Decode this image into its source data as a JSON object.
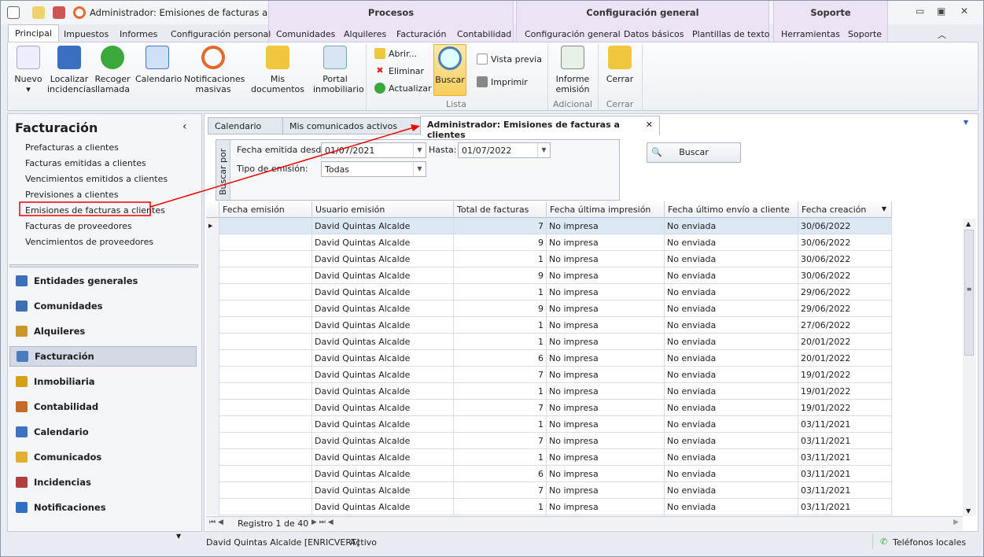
{
  "window": {
    "title": "Administrador: Emisiones de facturas a clientes",
    "minimize": "▭",
    "maximize": "▣",
    "close": "✕",
    "collapse": "︿"
  },
  "context_groups": [
    "Procesos",
    "Configuración general",
    "Soporte"
  ],
  "tabs": [
    "Principal",
    "Impuestos",
    "Informes",
    "Configuración personal",
    "Comunidades",
    "Alquileres",
    "Facturación",
    "Contabilidad",
    "Configuración general",
    "Datos básicos",
    "Plantillas de texto",
    "Herramientas",
    "Soporte"
  ],
  "ribbon": {
    "large": [
      "Nuevo",
      "Localizar incidencias",
      "Recoger llamada",
      "Calendario",
      "Notificaciones masivas",
      "Mis documentos",
      "Portal inmobiliario"
    ],
    "lista_small": [
      "Abrir...",
      "Eliminar",
      "Actualizar"
    ],
    "buscar": "Buscar",
    "print_small": [
      "Vista previa",
      "Imprimir"
    ],
    "informe": "Informe emisión",
    "cerrar": "Cerrar",
    "groups": {
      "lista": "Lista",
      "adicional": "Adicional",
      "cerrar": "Cerrar"
    }
  },
  "left": {
    "title": "Facturación",
    "collapse": "‹",
    "links": [
      "Prefacturas a clientes",
      "Facturas emitidas a clientes",
      "Vencimientos emitidos a clientes",
      "Previsiones a clientes",
      "Emisiones de facturas a clientes",
      "Facturas de proveedores",
      "Vencimientos de proveedores"
    ],
    "modules": [
      "Entidades generales",
      "Comunidades",
      "Alquileres",
      "Facturación",
      "Inmobiliaria",
      "Contabilidad",
      "Calendario",
      "Comunicados",
      "Incidencias",
      "Notificaciones"
    ],
    "module_colors": [
      "#3b6fb6",
      "#3f6fb0",
      "#c8962a",
      "#4b7bc0",
      "#d4a017",
      "#c46a2a",
      "#3f73c0",
      "#e0b030",
      "#b04040",
      "#3070c0"
    ]
  },
  "doc_tabs": [
    "Calendario",
    "Mis comunicados activos",
    "Administrador: Emisiones de facturas a clientes"
  ],
  "filter": {
    "group_label": "Buscar por",
    "desde_label": "Fecha emitida desde:",
    "desde": "01/07/2021",
    "hasta_label": "Hasta:",
    "hasta": "01/07/2022",
    "tipo_label": "Tipo de emisión:",
    "tipo": "Todas",
    "buscar": "Buscar"
  },
  "grid": {
    "columns": [
      "Fecha emisión",
      "Usuario emisión",
      "Total de facturas",
      "Fecha última impresión",
      "Fecha último envío a cliente",
      "Fecha creación"
    ],
    "rows": [
      [
        "",
        "David Quintas Alcalde",
        "7",
        "No impresa",
        "No enviada",
        "30/06/2022"
      ],
      [
        "",
        "David Quintas Alcalde",
        "9",
        "No impresa",
        "No enviada",
        "30/06/2022"
      ],
      [
        "",
        "David Quintas Alcalde",
        "1",
        "No impresa",
        "No enviada",
        "30/06/2022"
      ],
      [
        "",
        "David Quintas Alcalde",
        "9",
        "No impresa",
        "No enviada",
        "30/06/2022"
      ],
      [
        "",
        "David Quintas Alcalde",
        "1",
        "No impresa",
        "No enviada",
        "29/06/2022"
      ],
      [
        "",
        "David Quintas Alcalde",
        "9",
        "No impresa",
        "No enviada",
        "29/06/2022"
      ],
      [
        "",
        "David Quintas Alcalde",
        "1",
        "No impresa",
        "No enviada",
        "27/06/2022"
      ],
      [
        "",
        "David Quintas Alcalde",
        "1",
        "No impresa",
        "No enviada",
        "20/01/2022"
      ],
      [
        "",
        "David Quintas Alcalde",
        "6",
        "No impresa",
        "No enviada",
        "20/01/2022"
      ],
      [
        "",
        "David Quintas Alcalde",
        "7",
        "No impresa",
        "No enviada",
        "19/01/2022"
      ],
      [
        "",
        "David Quintas Alcalde",
        "1",
        "No impresa",
        "No enviada",
        "19/01/2022"
      ],
      [
        "",
        "David Quintas Alcalde",
        "7",
        "No impresa",
        "No enviada",
        "19/01/2022"
      ],
      [
        "",
        "David Quintas Alcalde",
        "1",
        "No impresa",
        "No enviada",
        "03/11/2021"
      ],
      [
        "",
        "David Quintas Alcalde",
        "7",
        "No impresa",
        "No enviada",
        "03/11/2021"
      ],
      [
        "",
        "David Quintas Alcalde",
        "1",
        "No impresa",
        "No enviada",
        "03/11/2021"
      ],
      [
        "",
        "David Quintas Alcalde",
        "6",
        "No impresa",
        "No enviada",
        "03/11/2021"
      ],
      [
        "",
        "David Quintas Alcalde",
        "7",
        "No impresa",
        "No enviada",
        "03/11/2021"
      ],
      [
        "",
        "David Quintas Alcalde",
        "1",
        "No impresa",
        "No enviada",
        "03/11/2021"
      ]
    ],
    "record": "Registro 1 de 40"
  },
  "status": {
    "user": "David Quintas Alcalde [ENRICVERT]",
    "state": "Activo",
    "phones": "Teléfonos locales"
  }
}
